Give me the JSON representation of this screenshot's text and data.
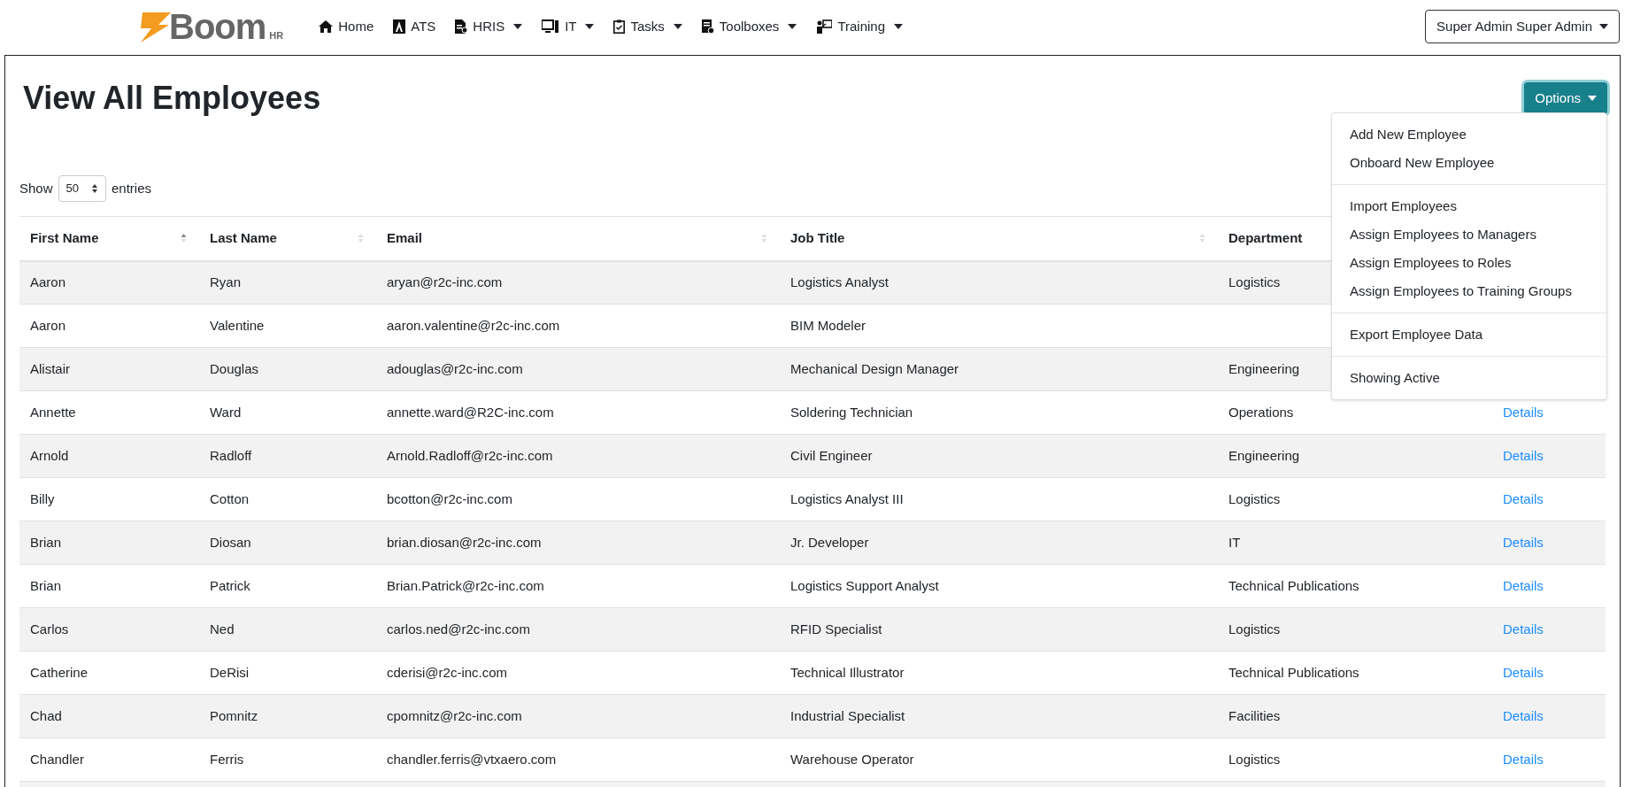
{
  "brand": {
    "name": "Boom",
    "suffix": "HR"
  },
  "nav": [
    {
      "label": "Home",
      "has_menu": false
    },
    {
      "label": "ATS",
      "has_menu": false
    },
    {
      "label": "HRIS",
      "has_menu": true
    },
    {
      "label": "IT",
      "has_menu": true
    },
    {
      "label": "Tasks",
      "has_menu": true
    },
    {
      "label": "Toolboxes",
      "has_menu": true
    },
    {
      "label": "Training",
      "has_menu": true
    }
  ],
  "user_menu": {
    "label": "Super Admin Super Admin"
  },
  "page_title": "View All Employees",
  "options_button": {
    "label": "Options",
    "expanded": true
  },
  "options_menu": [
    [
      {
        "label": "Add New Employee"
      },
      {
        "label": "Onboard New Employee"
      }
    ],
    [
      {
        "label": "Import Employees"
      },
      {
        "label": "Assign Employees to Managers"
      },
      {
        "label": "Assign Employees to Roles"
      },
      {
        "label": "Assign Employees to Training Groups"
      }
    ],
    [
      {
        "label": "Export Employee Data"
      }
    ],
    [
      {
        "label": "Showing Active"
      }
    ]
  ],
  "length_control": {
    "before": "Show",
    "value": "50",
    "after": "entries"
  },
  "table": {
    "columns": [
      {
        "label": "First Name",
        "sorted": true
      },
      {
        "label": "Last Name",
        "sorted": false
      },
      {
        "label": "Email",
        "sorted": false
      },
      {
        "label": "Job Title",
        "sorted": false
      },
      {
        "label": "Department"
      }
    ],
    "rows": [
      {
        "first": "Aaron",
        "last": "Ryan",
        "email": "aryan@r2c-inc.com",
        "job": "Logistics Analyst",
        "dept": "Logistics"
      },
      {
        "first": "Aaron",
        "last": "Valentine",
        "email": "aaron.valentine@r2c-inc.com",
        "job": "BIM Modeler"
      },
      {
        "first": "Alistair",
        "last": "Douglas",
        "email": "adouglas@r2c-inc.com",
        "job": "Mechanical Design Manager",
        "dept": "Engineering"
      },
      {
        "first": "Annette",
        "last": "Ward",
        "email": "annette.ward@R2C-inc.com",
        "job": "Soldering Technician",
        "dept": "Operations",
        "link": "Details"
      },
      {
        "first": "Arnold",
        "last": "Radloff",
        "email": "Arnold.Radloff@r2c-inc.com",
        "job": "Civil Engineer",
        "dept": "Engineering",
        "link": "Details"
      },
      {
        "first": "Billy",
        "last": "Cotton",
        "email": "bcotton@r2c-inc.com",
        "job": "Logistics Analyst III",
        "dept": "Logistics",
        "link": "Details"
      },
      {
        "first": "Brian",
        "last": "Diosan",
        "email": "brian.diosan@r2c-inc.com",
        "job": "Jr. Developer",
        "dept": "IT",
        "link": "Details"
      },
      {
        "first": "Brian",
        "last": "Patrick",
        "email": "Brian.Patrick@r2c-inc.com",
        "job": "Logistics Support Analyst",
        "dept": "Technical Publications",
        "link": "Details"
      },
      {
        "first": "Carlos",
        "last": "Ned",
        "email": "carlos.ned@r2c-inc.com",
        "job": "RFID Specialist",
        "dept": "Logistics",
        "link": "Details"
      },
      {
        "first": "Catherine",
        "last": "DeRisi",
        "email": "cderisi@r2c-inc.com",
        "job": "Technical Illustrator",
        "dept": "Technical Publications",
        "link": "Details"
      },
      {
        "first": "Chad",
        "last": "Pomnitz",
        "email": "cpomnitz@r2c-inc.com",
        "job": "Industrial Specialist",
        "dept": "Facilities",
        "link": "Details"
      },
      {
        "first": "Chandler",
        "last": "Ferris",
        "email": "chandler.ferris@vtxaero.com",
        "job": "Warehouse Operator",
        "dept": "Logistics",
        "link": "Details"
      }
    ]
  }
}
